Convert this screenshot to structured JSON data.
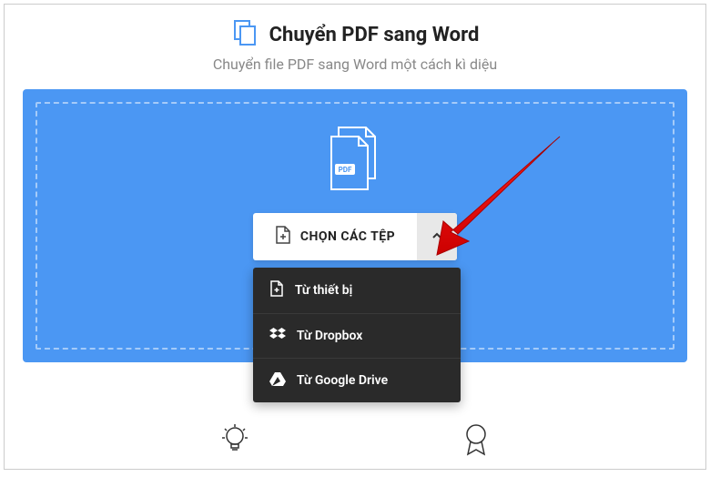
{
  "header": {
    "title": "Chuyển PDF sang Word",
    "subtitle": "Chuyển file PDF sang Word một cách kì diệu"
  },
  "select": {
    "label": "CHỌN CÁC TỆP"
  },
  "dropdown": {
    "items": [
      {
        "label": "Từ thiết bị"
      },
      {
        "label": "Từ Dropbox"
      },
      {
        "label": "Từ Google Drive"
      }
    ]
  }
}
